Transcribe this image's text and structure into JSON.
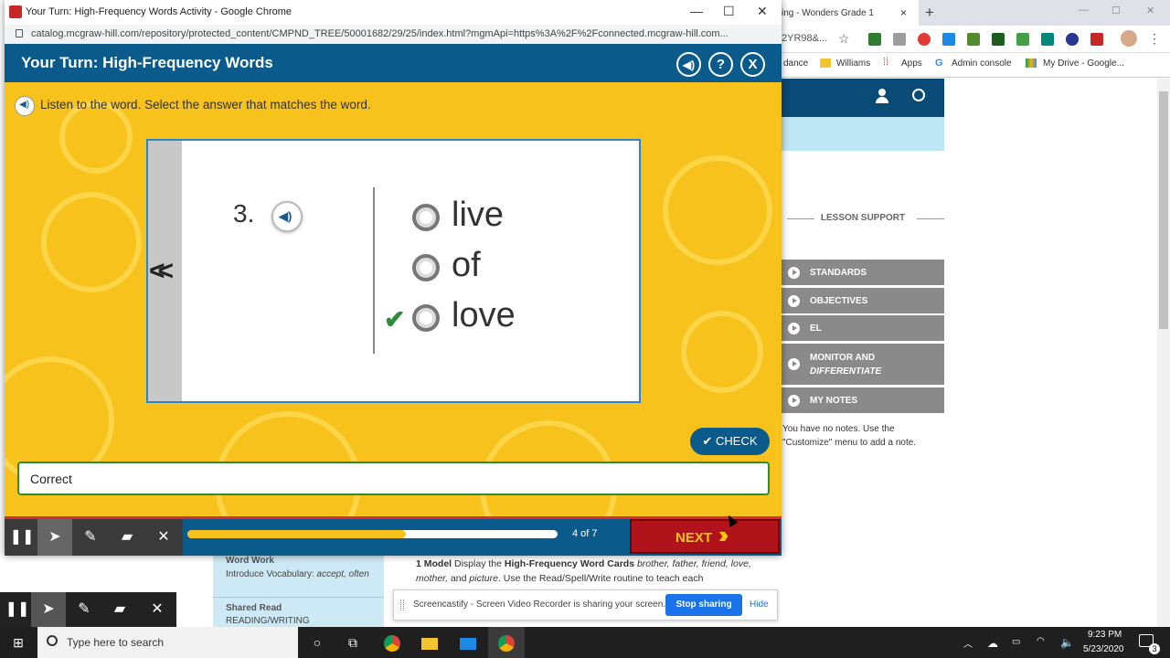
{
  "bg_browser": {
    "tab_title": "ing - Wonders Grade 1",
    "tab_close": "×",
    "new_tab": "+",
    "win_minimize": "—",
    "win_maximize": "☐",
    "win_close": "✕",
    "address_fragment": "2YR98&...",
    "bookmarks": [
      "dance",
      "Williams",
      "Apps",
      "Admin console",
      "My Drive - Google..."
    ],
    "lesson_support": "LESSON SUPPORT",
    "accordion": [
      "STANDARDS",
      "OBJECTIVES",
      "EL",
      "MONITOR AND",
      "DIFFERENTIATE",
      "MY NOTES"
    ],
    "notes_text": "You have no notes. Use the \"Customize\" menu to add a note.",
    "word_work_title": "Word Work",
    "word_work_text_1": "Introduce Vocabulary: ",
    "word_work_text_em": "accept, often",
    "shared_read_title": "Shared Read",
    "shared_read_text": "READING/WRITING",
    "model_text_1": "1 Model",
    "model_text_2": " Display the ",
    "model_text_3": "High-Frequency Word Cards",
    "model_text_4": " brother, father, friend, love, mother,",
    "model_text_5": " and ",
    "model_text_6": "picture",
    "model_text_7": ". Use the Read/Spell/Write routine to teach each"
  },
  "screencastify": {
    "message": "Screencastify - Screen Video Recorder is sharing your screen.",
    "stop": "Stop sharing",
    "hide": "Hide"
  },
  "taskbar": {
    "search_placeholder": "Type here to search",
    "time": "9:23 PM",
    "date": "5/23/2020",
    "notifications": "3"
  },
  "popup": {
    "window_title": "Your Turn: High-Frequency Words Activity - Google Chrome",
    "url": "catalog.mcgraw-hill.com/repository/protected_content/CMPND_TREE/50001682/29/25/index.html?mgmApi=https%3A%2F%2Fconnected.mcgraw-hill.com...",
    "activity_title": "Your Turn: High-Frequency Words",
    "help_label": "?",
    "close_label": "X",
    "instruction": "Listen to the word. Select the answer that matches the word.",
    "question_number": "3.",
    "options": [
      "live",
      "of",
      "love"
    ],
    "selected_option": "love",
    "check_label": "CHECK",
    "feedback": "Correct",
    "progress_label": "4 of 7",
    "progress_fraction": 0.59,
    "next_label": "NEXT",
    "accent_blue": "#0a5a8c",
    "accent_yellow": "#f8c21c",
    "correct_green": "#2e8b3a"
  }
}
